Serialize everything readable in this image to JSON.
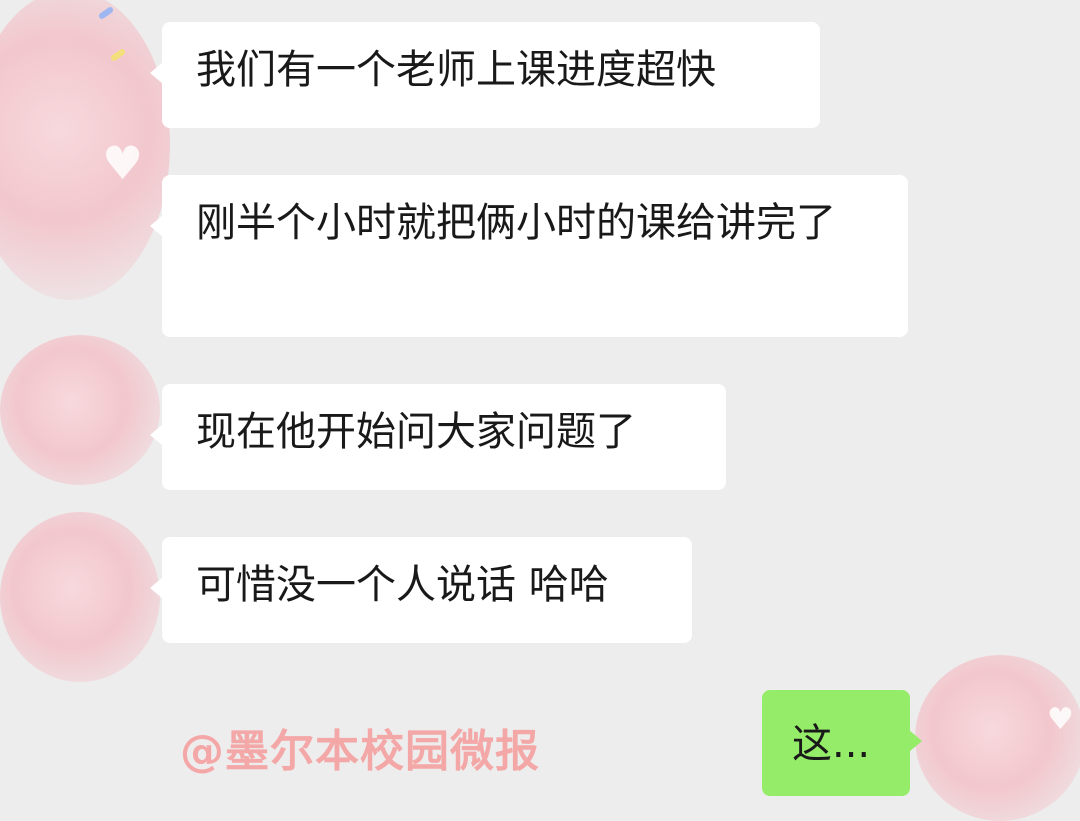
{
  "messages": [
    {
      "side": "received",
      "text": "我们有一个老师上课进度超快"
    },
    {
      "side": "received",
      "text": "刚半个小时就把俩小时的课给讲完了"
    },
    {
      "side": "received",
      "text": "现在他开始问大家问题了"
    },
    {
      "side": "received",
      "text": "可惜没一个人说话 哈哈"
    },
    {
      "side": "sent",
      "text": "这..."
    }
  ],
  "watermark": "@墨尔本校园微报",
  "icons": {
    "heart_decoration": "heart-icon"
  },
  "colors": {
    "chat_background": "#ededed",
    "received_bubble": "#ffffff",
    "sent_bubble": "#95ec69",
    "avatar_blur_pink": "#f2c7cd",
    "watermark_text": "#f4a7a7"
  }
}
